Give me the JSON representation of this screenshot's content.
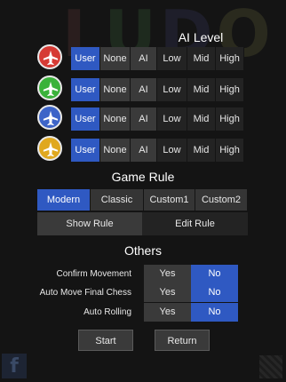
{
  "background_logo": "LUDO",
  "ai_level": {
    "title": "AI Level",
    "players": [
      {
        "color": "#d63a34",
        "icon": "airplane-icon",
        "modes": [
          "User",
          "None",
          "AI"
        ],
        "selected_mode": "User",
        "levels": [
          "Low",
          "Mid",
          "High"
        ]
      },
      {
        "color": "#3ab23a",
        "icon": "airplane-icon",
        "modes": [
          "User",
          "None",
          "AI"
        ],
        "selected_mode": "User",
        "levels": [
          "Low",
          "Mid",
          "High"
        ]
      },
      {
        "color": "#3d64c8",
        "icon": "airplane-icon",
        "modes": [
          "User",
          "None",
          "AI"
        ],
        "selected_mode": "User",
        "levels": [
          "Low",
          "Mid",
          "High"
        ]
      },
      {
        "color": "#e0a81e",
        "icon": "airplane-icon",
        "modes": [
          "User",
          "None",
          "AI"
        ],
        "selected_mode": "User",
        "levels": [
          "Low",
          "Mid",
          "High"
        ]
      }
    ]
  },
  "game_rule": {
    "title": "Game Rule",
    "options": [
      "Modern",
      "Classic",
      "Custom1",
      "Custom2"
    ],
    "selected": "Modern",
    "show_rule": "Show Rule",
    "edit_rule": "Edit Rule"
  },
  "others": {
    "title": "Others",
    "yes_label": "Yes",
    "no_label": "No",
    "items": [
      {
        "label": "Confirm Movement",
        "value": "No"
      },
      {
        "label": "Auto Move Final Chess",
        "value": "No"
      },
      {
        "label": "Auto Rolling",
        "value": "No"
      }
    ]
  },
  "actions": {
    "start": "Start",
    "return": "Return"
  },
  "corner_icons": {
    "left": "facebook-icon",
    "right": "qr-code-icon",
    "facebook_glyph": "f"
  }
}
